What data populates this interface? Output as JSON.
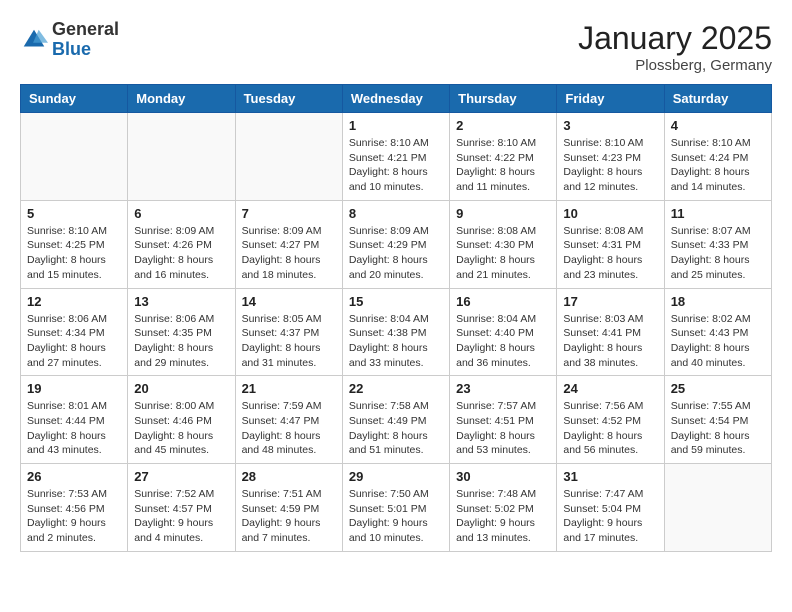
{
  "header": {
    "logo_general": "General",
    "logo_blue": "Blue",
    "month": "January 2025",
    "location": "Plossberg, Germany"
  },
  "days_of_week": [
    "Sunday",
    "Monday",
    "Tuesday",
    "Wednesday",
    "Thursday",
    "Friday",
    "Saturday"
  ],
  "weeks": [
    [
      {
        "day": "",
        "info": ""
      },
      {
        "day": "",
        "info": ""
      },
      {
        "day": "",
        "info": ""
      },
      {
        "day": "1",
        "info": "Sunrise: 8:10 AM\nSunset: 4:21 PM\nDaylight: 8 hours\nand 10 minutes."
      },
      {
        "day": "2",
        "info": "Sunrise: 8:10 AM\nSunset: 4:22 PM\nDaylight: 8 hours\nand 11 minutes."
      },
      {
        "day": "3",
        "info": "Sunrise: 8:10 AM\nSunset: 4:23 PM\nDaylight: 8 hours\nand 12 minutes."
      },
      {
        "day": "4",
        "info": "Sunrise: 8:10 AM\nSunset: 4:24 PM\nDaylight: 8 hours\nand 14 minutes."
      }
    ],
    [
      {
        "day": "5",
        "info": "Sunrise: 8:10 AM\nSunset: 4:25 PM\nDaylight: 8 hours\nand 15 minutes."
      },
      {
        "day": "6",
        "info": "Sunrise: 8:09 AM\nSunset: 4:26 PM\nDaylight: 8 hours\nand 16 minutes."
      },
      {
        "day": "7",
        "info": "Sunrise: 8:09 AM\nSunset: 4:27 PM\nDaylight: 8 hours\nand 18 minutes."
      },
      {
        "day": "8",
        "info": "Sunrise: 8:09 AM\nSunset: 4:29 PM\nDaylight: 8 hours\nand 20 minutes."
      },
      {
        "day": "9",
        "info": "Sunrise: 8:08 AM\nSunset: 4:30 PM\nDaylight: 8 hours\nand 21 minutes."
      },
      {
        "day": "10",
        "info": "Sunrise: 8:08 AM\nSunset: 4:31 PM\nDaylight: 8 hours\nand 23 minutes."
      },
      {
        "day": "11",
        "info": "Sunrise: 8:07 AM\nSunset: 4:33 PM\nDaylight: 8 hours\nand 25 minutes."
      }
    ],
    [
      {
        "day": "12",
        "info": "Sunrise: 8:06 AM\nSunset: 4:34 PM\nDaylight: 8 hours\nand 27 minutes."
      },
      {
        "day": "13",
        "info": "Sunrise: 8:06 AM\nSunset: 4:35 PM\nDaylight: 8 hours\nand 29 minutes."
      },
      {
        "day": "14",
        "info": "Sunrise: 8:05 AM\nSunset: 4:37 PM\nDaylight: 8 hours\nand 31 minutes."
      },
      {
        "day": "15",
        "info": "Sunrise: 8:04 AM\nSunset: 4:38 PM\nDaylight: 8 hours\nand 33 minutes."
      },
      {
        "day": "16",
        "info": "Sunrise: 8:04 AM\nSunset: 4:40 PM\nDaylight: 8 hours\nand 36 minutes."
      },
      {
        "day": "17",
        "info": "Sunrise: 8:03 AM\nSunset: 4:41 PM\nDaylight: 8 hours\nand 38 minutes."
      },
      {
        "day": "18",
        "info": "Sunrise: 8:02 AM\nSunset: 4:43 PM\nDaylight: 8 hours\nand 40 minutes."
      }
    ],
    [
      {
        "day": "19",
        "info": "Sunrise: 8:01 AM\nSunset: 4:44 PM\nDaylight: 8 hours\nand 43 minutes."
      },
      {
        "day": "20",
        "info": "Sunrise: 8:00 AM\nSunset: 4:46 PM\nDaylight: 8 hours\nand 45 minutes."
      },
      {
        "day": "21",
        "info": "Sunrise: 7:59 AM\nSunset: 4:47 PM\nDaylight: 8 hours\nand 48 minutes."
      },
      {
        "day": "22",
        "info": "Sunrise: 7:58 AM\nSunset: 4:49 PM\nDaylight: 8 hours\nand 51 minutes."
      },
      {
        "day": "23",
        "info": "Sunrise: 7:57 AM\nSunset: 4:51 PM\nDaylight: 8 hours\nand 53 minutes."
      },
      {
        "day": "24",
        "info": "Sunrise: 7:56 AM\nSunset: 4:52 PM\nDaylight: 8 hours\nand 56 minutes."
      },
      {
        "day": "25",
        "info": "Sunrise: 7:55 AM\nSunset: 4:54 PM\nDaylight: 8 hours\nand 59 minutes."
      }
    ],
    [
      {
        "day": "26",
        "info": "Sunrise: 7:53 AM\nSunset: 4:56 PM\nDaylight: 9 hours\nand 2 minutes."
      },
      {
        "day": "27",
        "info": "Sunrise: 7:52 AM\nSunset: 4:57 PM\nDaylight: 9 hours\nand 4 minutes."
      },
      {
        "day": "28",
        "info": "Sunrise: 7:51 AM\nSunset: 4:59 PM\nDaylight: 9 hours\nand 7 minutes."
      },
      {
        "day": "29",
        "info": "Sunrise: 7:50 AM\nSunset: 5:01 PM\nDaylight: 9 hours\nand 10 minutes."
      },
      {
        "day": "30",
        "info": "Sunrise: 7:48 AM\nSunset: 5:02 PM\nDaylight: 9 hours\nand 13 minutes."
      },
      {
        "day": "31",
        "info": "Sunrise: 7:47 AM\nSunset: 5:04 PM\nDaylight: 9 hours\nand 17 minutes."
      },
      {
        "day": "",
        "info": ""
      }
    ]
  ]
}
